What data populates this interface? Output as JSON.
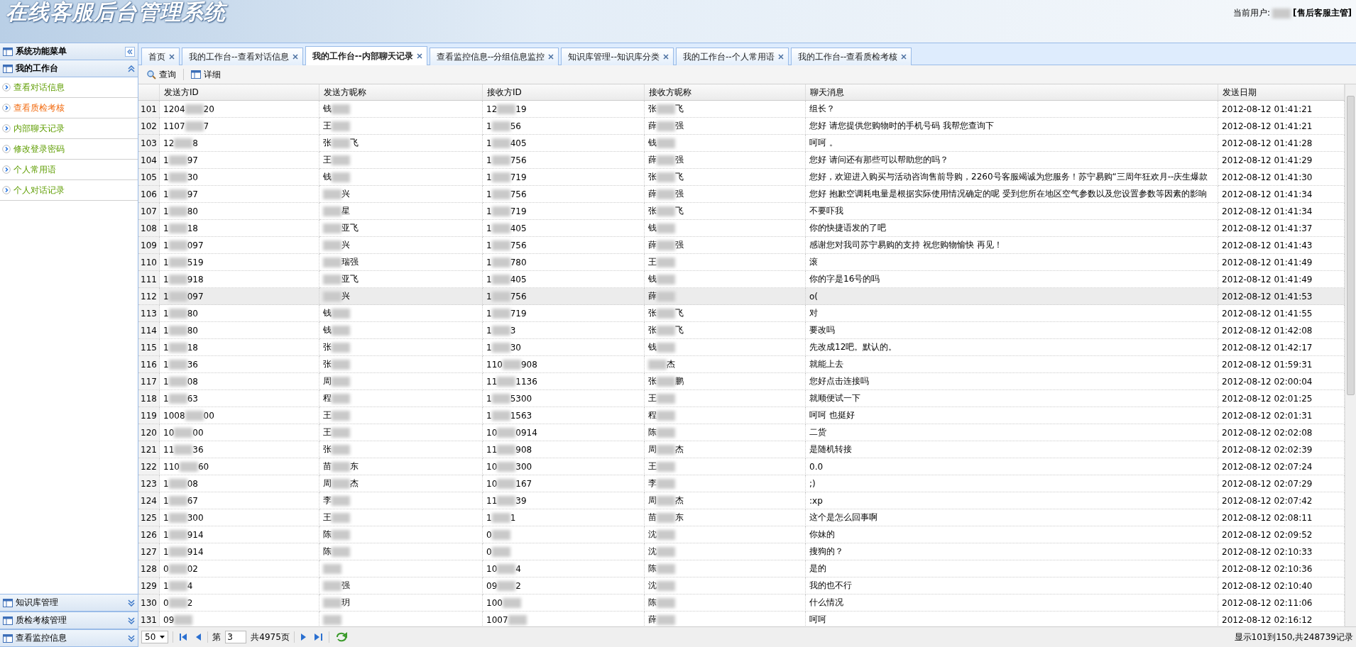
{
  "header": {
    "title": "在线客服后台管理系统",
    "user_label": "当前用户:",
    "user_role": "[售后客服主管]"
  },
  "sidebar": {
    "title": "系统功能菜单",
    "panels": [
      {
        "title": "我的工作台",
        "expanded": true,
        "items": [
          {
            "label": "查看对话信息",
            "selected": false
          },
          {
            "label": "查看质检考核",
            "selected": true
          },
          {
            "label": "内部聊天记录",
            "selected": false
          },
          {
            "label": "修改登录密码",
            "selected": false
          },
          {
            "label": "个人常用语",
            "selected": false
          },
          {
            "label": "个人对话记录",
            "selected": false
          }
        ]
      }
    ],
    "bottom_panels": [
      {
        "title": "知识库管理",
        "expanded": false
      },
      {
        "title": "质检考核管理",
        "expanded": false
      },
      {
        "title": "查看监控信息",
        "expanded": false
      }
    ]
  },
  "tabs": [
    {
      "label": "首页",
      "selected": false
    },
    {
      "label": "我的工作台--查看对话信息",
      "selected": false
    },
    {
      "label": "我的工作台--内部聊天记录",
      "selected": true
    },
    {
      "label": "查看监控信息--分组信息监控",
      "selected": false
    },
    {
      "label": "知识库管理--知识库分类",
      "selected": false
    },
    {
      "label": "我的工作台--个人常用语",
      "selected": false
    },
    {
      "label": "我的工作台--查看质检考核",
      "selected": false
    }
  ],
  "toolbar": [
    {
      "label": "查询",
      "kind": "search"
    },
    {
      "label": "详细",
      "kind": "detail"
    }
  ],
  "table": {
    "columns": [
      "发送方ID",
      "发送方昵称",
      "接收方ID",
      "接收方昵称",
      "聊天消息",
      "发送日期"
    ],
    "rows": [
      {
        "no": "101",
        "sender_id": {
          "head": "1204",
          "tail": "20"
        },
        "sender_name": {
          "head": "钱"
        },
        "receiver_id": {
          "head": "12",
          "tail": "19"
        },
        "receiver_name": {
          "head": "张",
          "tail": "飞"
        },
        "message": "组长？",
        "date": "2012-08-12 01:41:21",
        "selected": false
      },
      {
        "no": "102",
        "sender_id": {
          "head": "1107",
          "tail": "7"
        },
        "sender_name": {
          "head": "王"
        },
        "receiver_id": {
          "head": "1",
          "tail": "56"
        },
        "receiver_name": {
          "head": "薛",
          "tail": "强"
        },
        "message": "您好 请您提供您购物时的手机号码 我帮您查询下",
        "date": "2012-08-12 01:41:21",
        "selected": false
      },
      {
        "no": "103",
        "sender_id": {
          "head": "12",
          "tail": "8"
        },
        "sender_name": {
          "head": "张",
          "tail": "飞"
        },
        "receiver_id": {
          "head": "1",
          "tail": "405"
        },
        "receiver_name": {
          "head": "钱"
        },
        "message": "呵呵 。",
        "date": "2012-08-12 01:41:28",
        "selected": false
      },
      {
        "no": "104",
        "sender_id": {
          "head": "1",
          "tail": "97"
        },
        "sender_name": {
          "head": "王"
        },
        "receiver_id": {
          "head": "1",
          "tail": "756"
        },
        "receiver_name": {
          "head": "薛",
          "tail": "强"
        },
        "message": "您好 请问还有那些可以帮助您的吗？",
        "date": "2012-08-12 01:41:29",
        "selected": false
      },
      {
        "no": "105",
        "sender_id": {
          "head": "1",
          "tail": "30"
        },
        "sender_name": {
          "head": "钱"
        },
        "receiver_id": {
          "head": "1",
          "tail": "719"
        },
        "receiver_name": {
          "head": "张",
          "tail": "飞"
        },
        "message": "您好，欢迎进入购买与活动咨询售前导购，2260号客服竭诚为您服务！苏宁易购“三周年狂欢月--庆生爆款",
        "date": "2012-08-12 01:41:30",
        "selected": false
      },
      {
        "no": "106",
        "sender_id": {
          "head": "1",
          "tail": "97"
        },
        "sender_name": {
          "tail": "兴"
        },
        "receiver_id": {
          "head": "1",
          "tail": "756"
        },
        "receiver_name": {
          "head": "薛",
          "tail": "强"
        },
        "message": "您好 抱歉空调耗电量是根据实际使用情况确定的呢 受到您所在地区空气参数以及您设置参数等因素的影响",
        "date": "2012-08-12 01:41:34",
        "selected": false
      },
      {
        "no": "107",
        "sender_id": {
          "head": "1",
          "tail": "80"
        },
        "sender_name": {
          "tail": "星"
        },
        "receiver_id": {
          "head": "1",
          "tail": "719"
        },
        "receiver_name": {
          "head": "张",
          "tail": "飞"
        },
        "message": "不要吓我",
        "date": "2012-08-12 01:41:34",
        "selected": false
      },
      {
        "no": "108",
        "sender_id": {
          "head": "1",
          "tail": "18"
        },
        "sender_name": {
          "tail": "亚飞"
        },
        "receiver_id": {
          "head": "1",
          "tail": "405"
        },
        "receiver_name": {
          "head": "钱"
        },
        "message": "你的快捷语发的了吧",
        "date": "2012-08-12 01:41:37",
        "selected": false
      },
      {
        "no": "109",
        "sender_id": {
          "head": "1",
          "tail": "097"
        },
        "sender_name": {
          "tail": "兴"
        },
        "receiver_id": {
          "head": "1",
          "tail": "756"
        },
        "receiver_name": {
          "head": "薛",
          "tail": "强"
        },
        "message": "感谢您对我司苏宁易购的支持 祝您购物愉快 再见！",
        "date": "2012-08-12 01:41:43",
        "selected": false
      },
      {
        "no": "110",
        "sender_id": {
          "head": "1",
          "tail": "519"
        },
        "sender_name": {
          "tail": "瑞强"
        },
        "receiver_id": {
          "head": "1",
          "tail": "780"
        },
        "receiver_name": {
          "head": "王"
        },
        "message": "滚",
        "date": "2012-08-12 01:41:49",
        "selected": false
      },
      {
        "no": "111",
        "sender_id": {
          "head": "1",
          "tail": "918"
        },
        "sender_name": {
          "tail": "亚飞"
        },
        "receiver_id": {
          "head": "1",
          "tail": "405"
        },
        "receiver_name": {
          "head": "钱"
        },
        "message": "你的字是16号的吗",
        "date": "2012-08-12 01:41:49",
        "selected": false
      },
      {
        "no": "112",
        "sender_id": {
          "head": "1",
          "tail": "097"
        },
        "sender_name": {
          "tail": "兴"
        },
        "receiver_id": {
          "head": "1",
          "tail": "756"
        },
        "receiver_name": {
          "head": "薛"
        },
        "message": "o(",
        "date": "2012-08-12 01:41:53",
        "selected": true
      },
      {
        "no": "113",
        "sender_id": {
          "head": "1",
          "tail": "80"
        },
        "sender_name": {
          "head": "钱"
        },
        "receiver_id": {
          "head": "1",
          "tail": "719"
        },
        "receiver_name": {
          "head": "张",
          "tail": "飞"
        },
        "message": "对",
        "date": "2012-08-12 01:41:55",
        "selected": false
      },
      {
        "no": "114",
        "sender_id": {
          "head": "1",
          "tail": "80"
        },
        "sender_name": {
          "head": "钱"
        },
        "receiver_id": {
          "head": "1",
          "tail": "3"
        },
        "receiver_name": {
          "head": "张",
          "tail": "飞"
        },
        "message": "要改吗",
        "date": "2012-08-12 01:42:08",
        "selected": false
      },
      {
        "no": "115",
        "sender_id": {
          "head": "1",
          "tail": "18"
        },
        "sender_name": {
          "head": "张"
        },
        "receiver_id": {
          "head": "1",
          "tail": "30"
        },
        "receiver_name": {
          "head": "钱"
        },
        "message": "先改成12吧。默认的。",
        "date": "2012-08-12 01:42:17",
        "selected": false
      },
      {
        "no": "116",
        "sender_id": {
          "head": "1",
          "tail": "36"
        },
        "sender_name": {
          "head": "张"
        },
        "receiver_id": {
          "head": "110",
          "tail": "908"
        },
        "receiver_name": {
          "tail": "杰"
        },
        "message": "就能上去",
        "date": "2012-08-12 01:59:31",
        "selected": false
      },
      {
        "no": "117",
        "sender_id": {
          "head": "1",
          "tail": "08"
        },
        "sender_name": {
          "head": "周"
        },
        "receiver_id": {
          "head": "11",
          "tail": "1136"
        },
        "receiver_name": {
          "head": "张",
          "tail": "鹏"
        },
        "message": "您好点击连接吗",
        "date": "2012-08-12 02:00:04",
        "selected": false
      },
      {
        "no": "118",
        "sender_id": {
          "head": "1",
          "tail": "63"
        },
        "sender_name": {
          "head": "程"
        },
        "receiver_id": {
          "head": "1",
          "tail": "5300"
        },
        "receiver_name": {
          "head": "王"
        },
        "message": "就顺便试一下",
        "date": "2012-08-12 02:01:25",
        "selected": false
      },
      {
        "no": "119",
        "sender_id": {
          "head": "1008",
          "tail": "00"
        },
        "sender_name": {
          "head": "王"
        },
        "receiver_id": {
          "head": "1",
          "tail": "1563"
        },
        "receiver_name": {
          "head": "程"
        },
        "message": "呵呵 也挺好",
        "date": "2012-08-12 02:01:31",
        "selected": false
      },
      {
        "no": "120",
        "sender_id": {
          "head": "10",
          "tail": "00"
        },
        "sender_name": {
          "head": "王"
        },
        "receiver_id": {
          "head": "10",
          "tail": "0914"
        },
        "receiver_name": {
          "head": "陈"
        },
        "message": "二货",
        "date": "2012-08-12 02:02:08",
        "selected": false
      },
      {
        "no": "121",
        "sender_id": {
          "head": "11",
          "tail": "36"
        },
        "sender_name": {
          "head": "张"
        },
        "receiver_id": {
          "head": "11",
          "tail": "908"
        },
        "receiver_name": {
          "head": "周",
          "tail": "杰"
        },
        "message": "是随机转接",
        "date": "2012-08-12 02:02:39",
        "selected": false
      },
      {
        "no": "122",
        "sender_id": {
          "head": "110",
          "tail": "60"
        },
        "sender_name": {
          "head": "苗",
          "tail": "东"
        },
        "receiver_id": {
          "head": "10",
          "tail": "300"
        },
        "receiver_name": {
          "head": "王"
        },
        "message": "0.0",
        "date": "2012-08-12 02:07:24",
        "selected": false
      },
      {
        "no": "123",
        "sender_id": {
          "head": "1",
          "tail": "08"
        },
        "sender_name": {
          "head": "周",
          "tail": "杰"
        },
        "receiver_id": {
          "head": "10",
          "tail": "167"
        },
        "receiver_name": {
          "head": "李"
        },
        "message": ";)",
        "date": "2012-08-12 02:07:29",
        "selected": false
      },
      {
        "no": "124",
        "sender_id": {
          "head": "1",
          "tail": "67"
        },
        "sender_name": {
          "head": "李"
        },
        "receiver_id": {
          "head": "11",
          "tail": "39"
        },
        "receiver_name": {
          "head": "周",
          "tail": "杰"
        },
        "message": ":xp",
        "date": "2012-08-12 02:07:42",
        "selected": false
      },
      {
        "no": "125",
        "sender_id": {
          "head": "1",
          "tail": "300"
        },
        "sender_name": {
          "head": "王"
        },
        "receiver_id": {
          "head": "1",
          "tail": "1"
        },
        "receiver_name": {
          "head": "苗",
          "tail": "东"
        },
        "message": "这个是怎么回事啊",
        "date": "2012-08-12 02:08:11",
        "selected": false
      },
      {
        "no": "126",
        "sender_id": {
          "head": "1",
          "tail": "914"
        },
        "sender_name": {
          "head": "陈"
        },
        "receiver_id": {
          "head": "0"
        },
        "receiver_name": {
          "head": "沈"
        },
        "message": "你妹的",
        "date": "2012-08-12 02:09:52",
        "selected": false
      },
      {
        "no": "127",
        "sender_id": {
          "head": "1",
          "tail": "914"
        },
        "sender_name": {
          "head": "陈"
        },
        "receiver_id": {
          "head": "0"
        },
        "receiver_name": {
          "head": "沈"
        },
        "message": "搜狗的？",
        "date": "2012-08-12 02:10:33",
        "selected": false
      },
      {
        "no": "128",
        "sender_id": {
          "head": "0",
          "tail": "02"
        },
        "receiver_id": {
          "head": "10",
          "tail": "4"
        },
        "receiver_name": {
          "head": "陈"
        },
        "message": "是的",
        "date": "2012-08-12 02:10:36",
        "selected": false
      },
      {
        "no": "129",
        "sender_id": {
          "head": "1",
          "tail": "4"
        },
        "sender_name": {
          "tail": "强"
        },
        "receiver_id": {
          "head": "09",
          "tail": "2"
        },
        "receiver_name": {
          "head": "沈"
        },
        "message": "我的也不行",
        "date": "2012-08-12 02:10:40",
        "selected": false
      },
      {
        "no": "130",
        "sender_id": {
          "head": "0",
          "tail": "2"
        },
        "sender_name": {
          "tail": "玥"
        },
        "receiver_id": {
          "head": "100"
        },
        "receiver_name": {
          "head": "陈"
        },
        "message": "什么情况",
        "date": "2012-08-12 02:11:06",
        "selected": false
      },
      {
        "no": "131",
        "sender_id": {
          "head": "09"
        },
        "receiver_id": {
          "head": "1007"
        },
        "receiver_name": {
          "head": "薛"
        },
        "message": "呵呵",
        "date": "2012-08-12 02:16:12",
        "selected": false
      }
    ]
  },
  "pager": {
    "page_size": "50",
    "page_prefix": "第",
    "page": "3",
    "page_total": "共4975页",
    "summary": "显示101到150,共248739记录"
  }
}
